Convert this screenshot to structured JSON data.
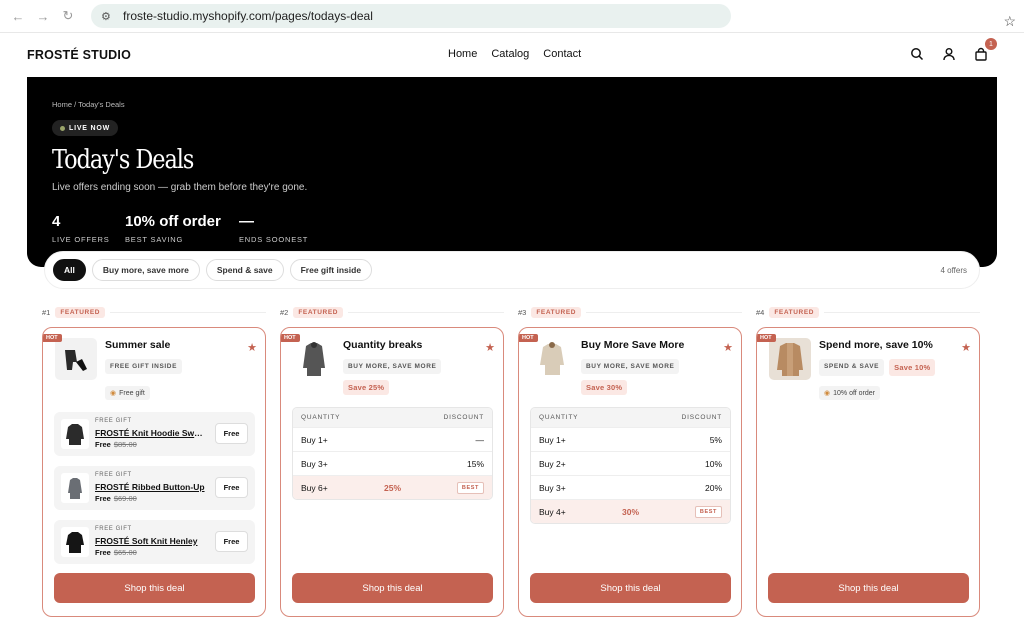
{
  "browser": {
    "url": "froste-studio.myshopify.com/pages/todays-deal"
  },
  "header": {
    "brand": "FROSTÉ STUDIO",
    "nav": [
      "Home",
      "Catalog",
      "Contact"
    ],
    "cart_count": "1"
  },
  "hero": {
    "breadcrumb": "Home / Today's Deals",
    "live_label": "LIVE NOW",
    "title": "Today's Deals",
    "subtitle": "Live offers ending soon — grab them before they're gone.",
    "stats": [
      {
        "value": "4",
        "label": "LIVE OFFERS"
      },
      {
        "value": "10% off order",
        "label": "BEST SAVING"
      },
      {
        "value": "—",
        "label": "ENDS SOONEST"
      }
    ]
  },
  "filters": {
    "chips": [
      "All",
      "Buy more, save more",
      "Spend & save",
      "Free gift inside"
    ],
    "count": "4 offers"
  },
  "deals": [
    {
      "rank": "#1",
      "featured": "FEATURED",
      "hot": "HOT",
      "title": "Summer sale",
      "tag": "FREE GIFT INSIDE",
      "pill": "Free gift",
      "button": "Shop this deal",
      "gifts": [
        {
          "label": "FREE GIFT",
          "name": "FROSTÉ Knit Hoodie Sweater",
          "price": "Free",
          "old": "$85.00",
          "btn": "Free"
        },
        {
          "label": "FREE GIFT",
          "name": "FROSTÉ Ribbed Button-Up",
          "price": "Free",
          "old": "$69.00",
          "btn": "Free"
        },
        {
          "label": "FREE GIFT",
          "name": "FROSTÉ Soft Knit Henley",
          "price": "Free",
          "old": "$65.00",
          "btn": "Free"
        }
      ]
    },
    {
      "rank": "#2",
      "featured": "FEATURED",
      "hot": "HOT",
      "title": "Quantity breaks",
      "tag": "BUY MORE, SAVE MORE",
      "save": "Save 25%",
      "button": "Shop this deal",
      "table": {
        "h1": "QUANTITY",
        "h2": "DISCOUNT",
        "rows": [
          {
            "q": "Buy 1+",
            "d": "—"
          },
          {
            "q": "Buy 3+",
            "d": "15%"
          }
        ],
        "best": {
          "q": "Buy 6+",
          "d": "25%",
          "badge": "BEST"
        }
      }
    },
    {
      "rank": "#3",
      "featured": "FEATURED",
      "hot": "HOT",
      "title": "Buy More Save More",
      "tag": "BUY MORE, SAVE MORE",
      "save": "Save 30%",
      "button": "Shop this deal",
      "table": {
        "h1": "QUANTITY",
        "h2": "DISCOUNT",
        "rows": [
          {
            "q": "Buy 1+",
            "d": "5%"
          },
          {
            "q": "Buy 2+",
            "d": "10%"
          },
          {
            "q": "Buy 3+",
            "d": "20%"
          }
        ],
        "best": {
          "q": "Buy 4+",
          "d": "30%",
          "badge": "BEST"
        }
      }
    },
    {
      "rank": "#4",
      "featured": "FEATURED",
      "hot": "HOT",
      "title": "Spend more, save 10%",
      "tag": "SPEND & SAVE",
      "save": "Save 10%",
      "pill": "10% off order",
      "button": "Shop this deal"
    }
  ],
  "colors": {
    "accent": "#c46251",
    "hero_bg": "#000000"
  }
}
